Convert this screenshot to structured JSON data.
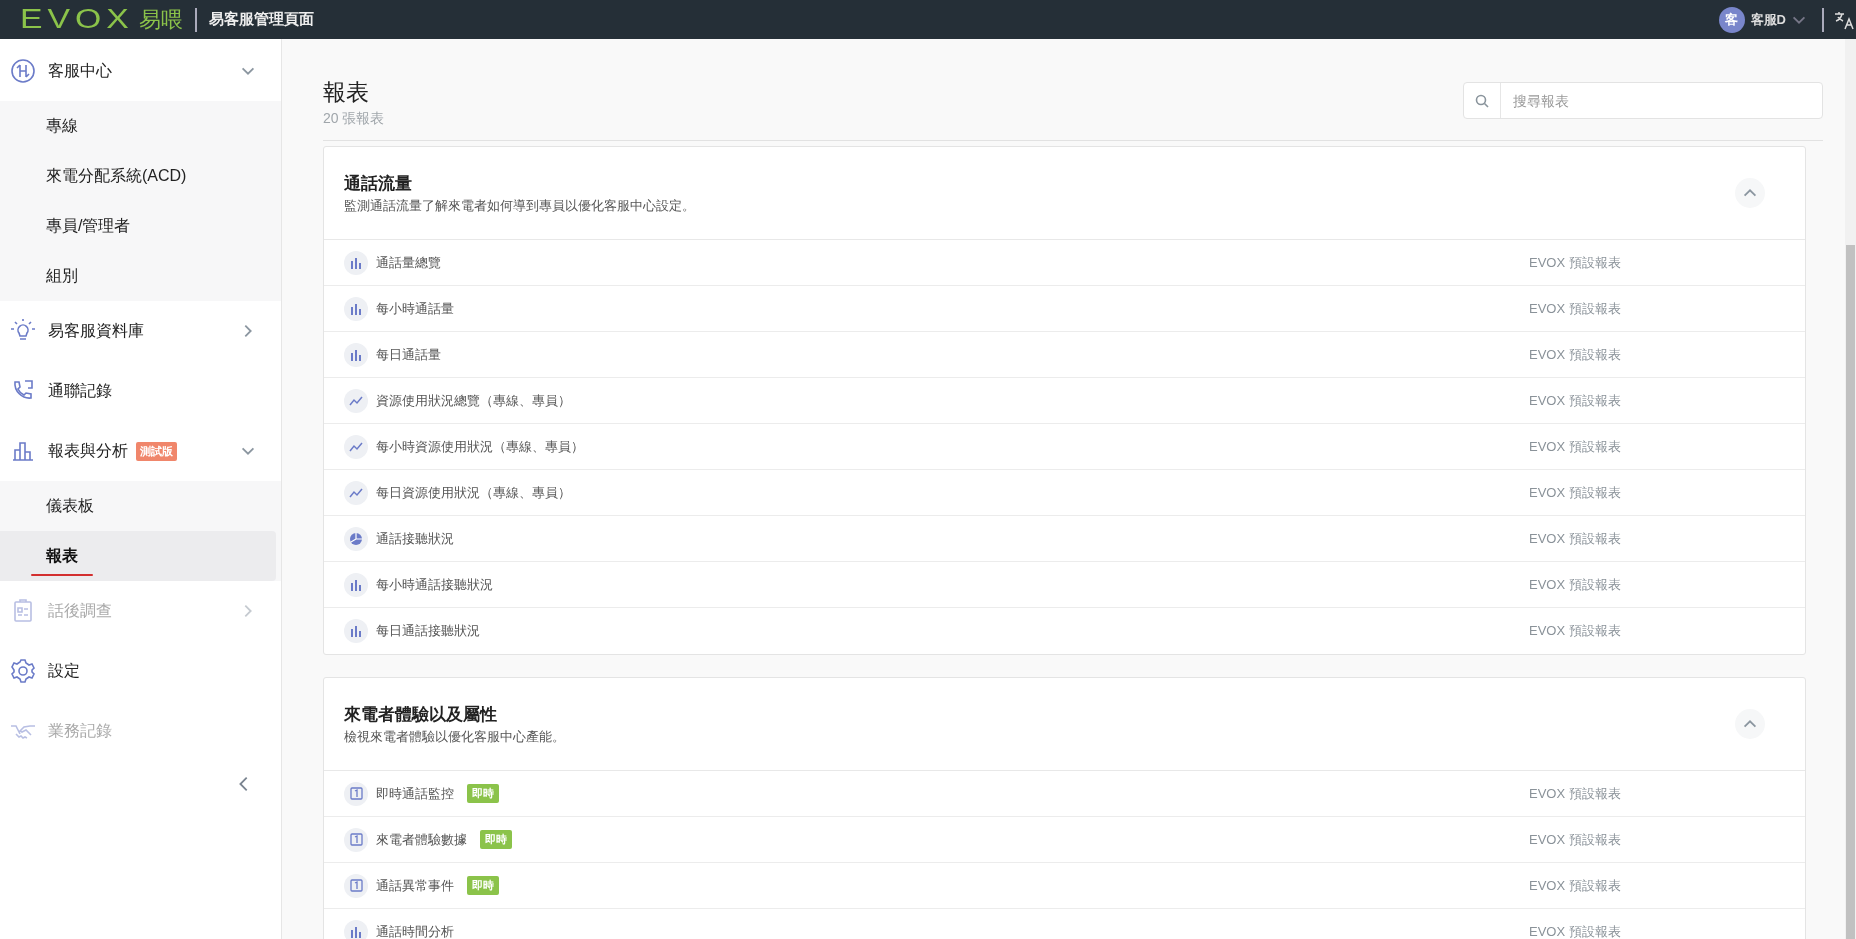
{
  "topbar": {
    "logo": "EVOX",
    "logo_cn": "易喂",
    "title": "易客服管理頁面",
    "user": {
      "avatar": "客",
      "name": "客服D"
    }
  },
  "sidebar": {
    "items": [
      {
        "label": "客服中心",
        "expanded": true,
        "disabled": false,
        "children": [
          {
            "label": "專線",
            "selected": false
          },
          {
            "label": "來電分配系統(ACD)",
            "selected": false
          },
          {
            "label": "專員/管理者",
            "selected": false
          },
          {
            "label": "組別",
            "selected": false
          }
        ]
      },
      {
        "label": "易客服資料庫",
        "expanded": false,
        "disabled": false
      },
      {
        "label": "通聯記錄",
        "disabled": false
      },
      {
        "label": "報表與分析",
        "badge": "測試版",
        "expanded": true,
        "disabled": false,
        "children": [
          {
            "label": "儀表板",
            "selected": false
          },
          {
            "label": "報表",
            "selected": true
          }
        ]
      },
      {
        "label": "話後調查",
        "expanded": false,
        "disabled": true
      },
      {
        "label": "設定",
        "disabled": false
      },
      {
        "label": "業務記錄",
        "disabled": true
      }
    ]
  },
  "page": {
    "title": "報表",
    "count": "20 張報表",
    "search": {
      "placeholder": "搜尋報表"
    }
  },
  "sections": [
    {
      "title": "通話流量",
      "description": "監測通話流量了解來電者如何導到專員以優化客服中心設定。",
      "expanded": true,
      "reports": [
        {
          "kind": "bar",
          "name": "通話量總覽",
          "source": "EVOX 預設報表"
        },
        {
          "kind": "bar",
          "name": "每小時通話量",
          "source": "EVOX 預設報表"
        },
        {
          "kind": "bar",
          "name": "每日通話量",
          "source": "EVOX 預設報表"
        },
        {
          "kind": "line",
          "name": "資源使用狀況總覽（專線、專員）",
          "source": "EVOX 預設報表"
        },
        {
          "kind": "line",
          "name": "每小時資源使用狀況（專線、專員）",
          "source": "EVOX 預設報表"
        },
        {
          "kind": "line",
          "name": "每日資源使用狀況（專線、專員）",
          "source": "EVOX 預設報表"
        },
        {
          "kind": "pie",
          "name": "通話接聽狀況",
          "source": "EVOX 預設報表"
        },
        {
          "kind": "bar",
          "name": "每小時通話接聽狀況",
          "source": "EVOX 預設報表"
        },
        {
          "kind": "bar",
          "name": "每日通話接聽狀況",
          "source": "EVOX 預設報表"
        }
      ]
    },
    {
      "title": "來電者體驗以及屬性",
      "description": "檢視來電者體驗以優化客服中心產能。",
      "expanded": true,
      "reports": [
        {
          "kind": "live",
          "name": "即時通話監控",
          "tag": "即時",
          "source": "EVOX 預設報表"
        },
        {
          "kind": "live",
          "name": "來電者體驗數據",
          "tag": "即時",
          "source": "EVOX 預設報表"
        },
        {
          "kind": "live",
          "name": "通話異常事件",
          "tag": "即時",
          "source": "EVOX 預設報表"
        },
        {
          "kind": "bar",
          "name": "通話時間分析",
          "source": "EVOX 預設報表"
        }
      ]
    }
  ]
}
